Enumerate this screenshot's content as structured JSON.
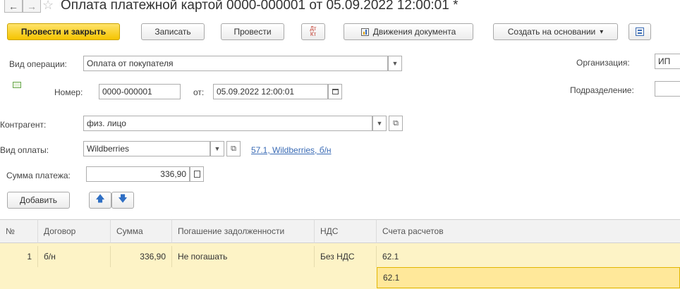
{
  "window": {
    "title": "Оплата платежной картой 0000-000001 от 05.09.2022 12:00:01 *",
    "back_glyph": "←",
    "forward_glyph": "→",
    "star_glyph": "☆"
  },
  "toolbar": {
    "post_close": "Провести и закрыть",
    "save": "Записать",
    "post": "Провести",
    "dtkt_top": "Дт",
    "dtkt_bottom": "Кт",
    "movements": "Движения документа",
    "create_based": "Создать на основании",
    "create_based_arrow": "▾"
  },
  "form": {
    "operation_label": "Вид операции:",
    "operation_value": "Оплата от покупателя",
    "number_label": "Номер:",
    "number_value": "0000-000001",
    "date_label": "от:",
    "date_value": "05.09.2022 12:00:01",
    "counterparty_label": "Контрагент:",
    "counterparty_value": "физ. лицо",
    "payment_type_label": "Вид оплаты:",
    "payment_type_value": "Wildberries",
    "payment_link": "57.1, Wildberries, б/н",
    "amount_label": "Сумма платежа:",
    "amount_value": "336,90",
    "organization_label": "Организация:",
    "organization_value": "ИП",
    "division_label": "Подразделение:",
    "division_value": ""
  },
  "table_toolbar": {
    "add": "Добавить"
  },
  "table": {
    "headers": [
      "№",
      "Договор",
      "Сумма",
      "Погашение задолженности",
      "НДС",
      "Счета расчетов"
    ],
    "rows": [
      {
        "n": "1",
        "contract": "б/н",
        "amount": "336,90",
        "repayment": "Не погашать",
        "vat": "Без НДС",
        "account1": "62.1",
        "account2": "62.1"
      }
    ]
  },
  "colors": {
    "primary_button": "#f5c400",
    "row_highlight": "#fdf3c6",
    "active_cell": "#ffe89a",
    "link": "#3a6bb5"
  }
}
